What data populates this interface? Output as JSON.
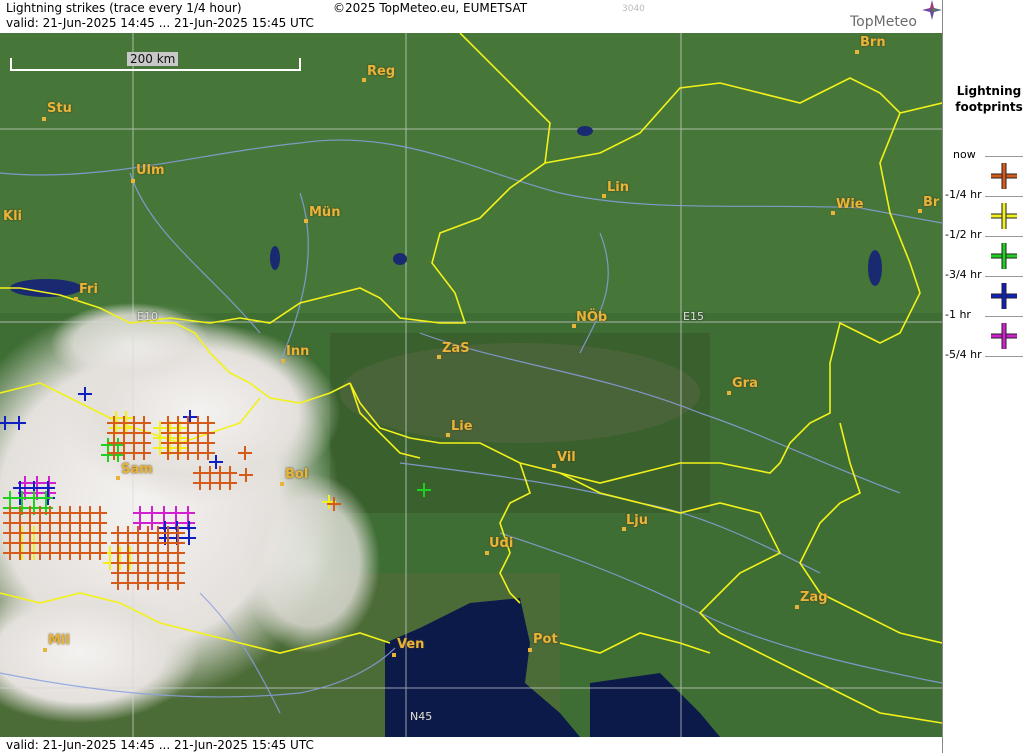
{
  "header": {
    "title": "Lightning strikes (trace every 1/4 hour)",
    "copyright": "©2025 TopMeteo.eu, EUMETSAT",
    "product_id": "3040",
    "valid": "valid:  21-Jun-2025 14:45 ... 21-Jun-2025 15:45 UTC",
    "logo": "TopMeteo"
  },
  "footer": {
    "valid": "valid:  21-Jun-2025 14:45 ... 21-Jun-2025 15:45 UTC"
  },
  "scale": {
    "label": "200 km"
  },
  "grid_labels": {
    "e10": "E10",
    "e15": "E15",
    "n45": "N45"
  },
  "cities": [
    {
      "name": "Brn"
    },
    {
      "name": "Reg"
    },
    {
      "name": "Stu"
    },
    {
      "name": "Ulm"
    },
    {
      "name": "Kli"
    },
    {
      "name": "Lin"
    },
    {
      "name": "Wie"
    },
    {
      "name": "Br"
    },
    {
      "name": "Mün"
    },
    {
      "name": "Fri"
    },
    {
      "name": "NÖb"
    },
    {
      "name": "Inn"
    },
    {
      "name": "ZaS"
    },
    {
      "name": "Gra"
    },
    {
      "name": "Lie"
    },
    {
      "name": "Vil"
    },
    {
      "name": "Sam"
    },
    {
      "name": "Bol"
    },
    {
      "name": "Lju"
    },
    {
      "name": "Udi"
    },
    {
      "name": "Zag"
    },
    {
      "name": "Pot"
    },
    {
      "name": "Mil"
    },
    {
      "name": "Ven"
    }
  ],
  "legend": {
    "title_line1": "Lightning",
    "title_line2": "footprints",
    "items": [
      {
        "label": "now",
        "color": "#d65a1a"
      },
      {
        "label": "-1/4 hr",
        "color": "#f0f020"
      },
      {
        "label": "-1/2 hr",
        "color": "#20d020"
      },
      {
        "label": "-3/4 hr",
        "color": "#1020c0"
      },
      {
        "label": "-1 hr",
        "color": "#d020d0"
      },
      {
        "label": "-5/4 hr",
        "color": ""
      }
    ]
  },
  "colors": {
    "border": "#f2f21a",
    "river": "#8aa0e0",
    "city": "#e8b43a",
    "sea": "#0c1a4a"
  }
}
